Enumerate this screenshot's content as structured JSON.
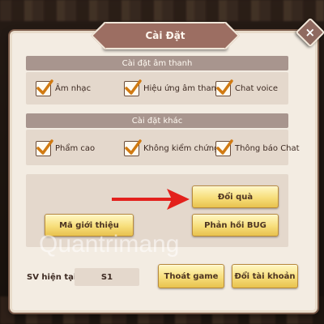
{
  "dialog": {
    "title": "Cài Đặt",
    "close_symbol": "×"
  },
  "sound_settings": {
    "header": "Cài đặt âm thanh",
    "options": [
      {
        "label": "Âm nhạc",
        "checked": true
      },
      {
        "label": "Hiệu ứng âm thanh",
        "checked": true
      },
      {
        "label": "Chat voice",
        "checked": true
      }
    ]
  },
  "other_settings": {
    "header": "Cài đặt khác",
    "options": [
      {
        "label": "Phẩm cao",
        "checked": true
      },
      {
        "label": "Không kiểm chứng",
        "checked": true
      },
      {
        "label": "Thông báo Chat",
        "checked": true
      }
    ]
  },
  "buttons": {
    "redeem": "Đổi quà",
    "referral_code": "Mã giới thiệu",
    "report_bug": "Phản hồi BUG",
    "exit_game": "Thoát game",
    "switch_account": "Đổi tài khoản"
  },
  "server": {
    "label": "SV hiện tại:",
    "value": "S1"
  },
  "watermark": "Quantrimang",
  "colors": {
    "panel_bg": "#f3ece2",
    "title_bg": "#9c6e62",
    "section_bar": "#a8958e",
    "button_yellow": "#f7de7b",
    "arrow_red": "#e3211c",
    "check_orange": "#d07a12"
  },
  "icons": {
    "checkmark": "check-icon",
    "close": "close-icon",
    "pointer": "red-arrow"
  }
}
